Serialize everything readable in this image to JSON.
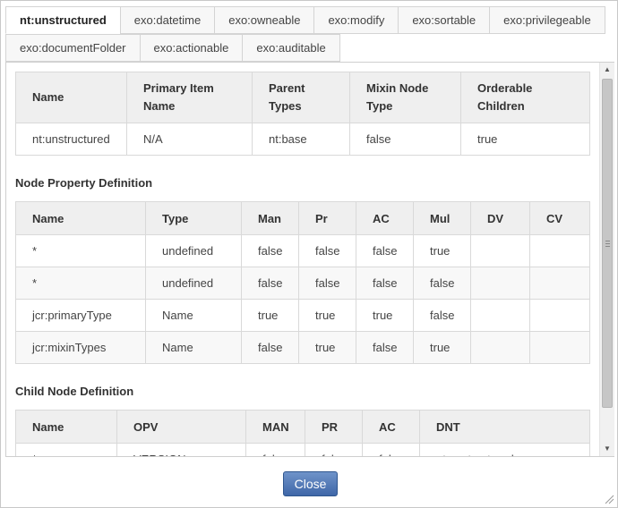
{
  "tabs": {
    "row1": [
      "nt:unstructured",
      "exo:datetime",
      "exo:owneable",
      "exo:modify",
      "exo:sortable",
      "exo:privilegeable"
    ],
    "row2": [
      "exo:documentFolder",
      "exo:actionable",
      "exo:auditable"
    ],
    "active": "nt:unstructured"
  },
  "node_type": {
    "headers": [
      "Name",
      "Primary Item Name",
      "Parent Types",
      "Mixin Node Type",
      "Orderable Children"
    ],
    "row": [
      "nt:unstructured",
      "N/A",
      "nt:base",
      "false",
      "true"
    ]
  },
  "property_section": {
    "title": "Node Property Definition",
    "headers": [
      "Name",
      "Type",
      "Man",
      "Pr",
      "AC",
      "Mul",
      "DV",
      "CV"
    ],
    "rows": [
      [
        "*",
        "undefined",
        "false",
        "false",
        "false",
        "true",
        "",
        ""
      ],
      [
        "*",
        "undefined",
        "false",
        "false",
        "false",
        "false",
        "",
        ""
      ],
      [
        "jcr:primaryType",
        "Name",
        "true",
        "true",
        "true",
        "false",
        "",
        ""
      ],
      [
        "jcr:mixinTypes",
        "Name",
        "false",
        "true",
        "false",
        "true",
        "",
        ""
      ]
    ]
  },
  "child_section": {
    "title": "Child Node Definition",
    "headers": [
      "Name",
      "OPV",
      "MAN",
      "PR",
      "AC",
      "DNT"
    ],
    "rows": [
      [
        "*",
        "VERSION",
        "false",
        "false",
        "false",
        "nt:unstructured"
      ]
    ]
  },
  "footer": {
    "close_label": "Close"
  }
}
